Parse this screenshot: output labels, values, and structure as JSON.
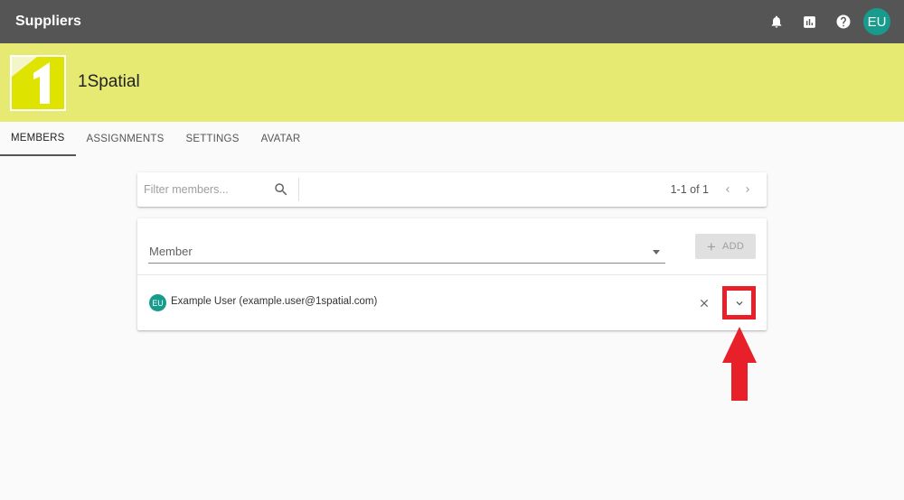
{
  "app": {
    "title": "Suppliers"
  },
  "topbar": {
    "icons": [
      "bell-icon",
      "chart-icon",
      "help-icon"
    ],
    "user_initials": "EU"
  },
  "organization": {
    "name": "1Spatial",
    "logo_digit": "1",
    "brand_color": "#e6ea73"
  },
  "tabs": [
    {
      "label": "MEMBERS",
      "active": true
    },
    {
      "label": "ASSIGNMENTS",
      "active": false
    },
    {
      "label": "SETTINGS",
      "active": false
    },
    {
      "label": "AVATAR",
      "active": false
    }
  ],
  "filter": {
    "placeholder": "Filter members...",
    "pagination": "1-1 of 1"
  },
  "members_panel": {
    "select_label": "Member",
    "add_label": "ADD",
    "members": [
      {
        "initials": "EU",
        "name": "Example User (example.user@1spatial.com)"
      }
    ]
  },
  "colors": {
    "topbar": "#555555",
    "avatar": "#179b8c",
    "highlight": "#e8202a"
  }
}
